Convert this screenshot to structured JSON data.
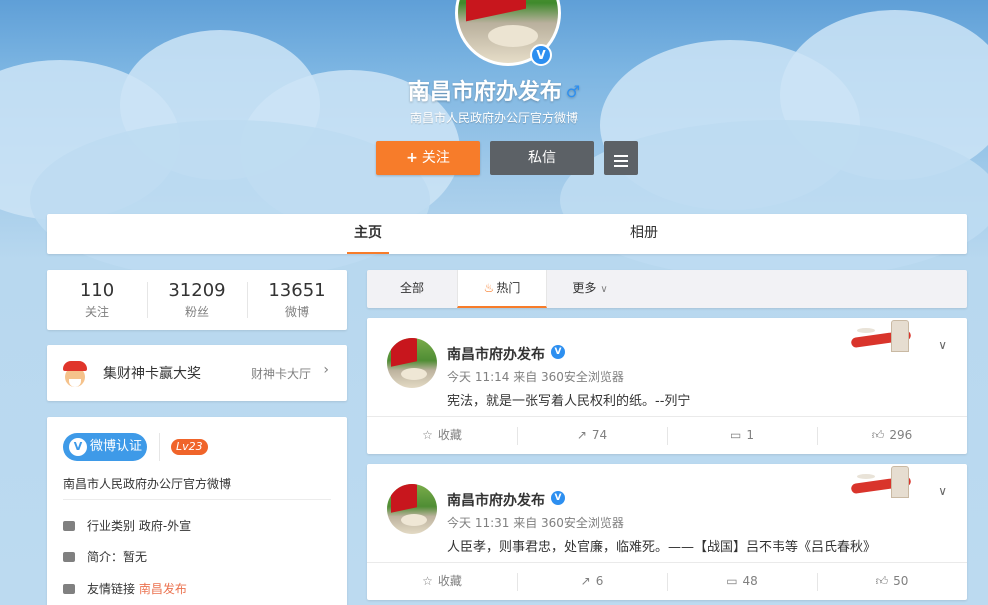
{
  "profile": {
    "name": "南昌市府办发布",
    "subtitle": "南昌市人民政府办公厅官方微博",
    "follow_label": "关注",
    "message_label": "私信"
  },
  "tabs": {
    "home": "主页",
    "album": "相册"
  },
  "stats": [
    {
      "value": "110",
      "label": "关注"
    },
    {
      "value": "31209",
      "label": "粉丝"
    },
    {
      "value": "13651",
      "label": "微博"
    }
  ],
  "promo": {
    "title": "集财神卡赢大奖",
    "link": "财神卡大厅"
  },
  "info": {
    "verify_label": "微博认证",
    "level": "Lv23",
    "description": "南昌市人民政府办公厅官方微博",
    "industry_label": "行业类别",
    "industry_value": "政府-外宣",
    "intro_label": "简介：",
    "intro_value": "暂无",
    "links_label": "友情链接",
    "links_value": "南昌发布"
  },
  "filter": {
    "all": "全部",
    "hot": "热门",
    "more": "更多"
  },
  "posts": [
    {
      "author": "南昌市府办发布",
      "meta": "今天 11:14 来自 360安全浏览器",
      "text": "宪法，就是一张写着人民权利的纸。--列宁",
      "fav_label": "收藏",
      "reposts": "74",
      "comments": "1",
      "likes": "296"
    },
    {
      "author": "南昌市府办发布",
      "meta": "今天 11:31 来自 360安全浏览器",
      "text": "人臣孝，则事君忠，处官廉，临难死。——【战国】吕不韦等《吕氏春秋》",
      "fav_label": "收藏",
      "reposts": "6",
      "comments": "48",
      "likes": "50"
    }
  ],
  "icons": {
    "verified": "verified-v-icon",
    "gender": "male-icon",
    "menu": "hamburger-icon",
    "hot": "flame-icon",
    "favorite": "star-icon",
    "repost": "share-icon",
    "comment": "comment-icon",
    "like": "thumbs-up-icon"
  },
  "colors": {
    "accent": "#f77c2a",
    "verify": "#2d8ff0",
    "link": "#eb7350"
  }
}
